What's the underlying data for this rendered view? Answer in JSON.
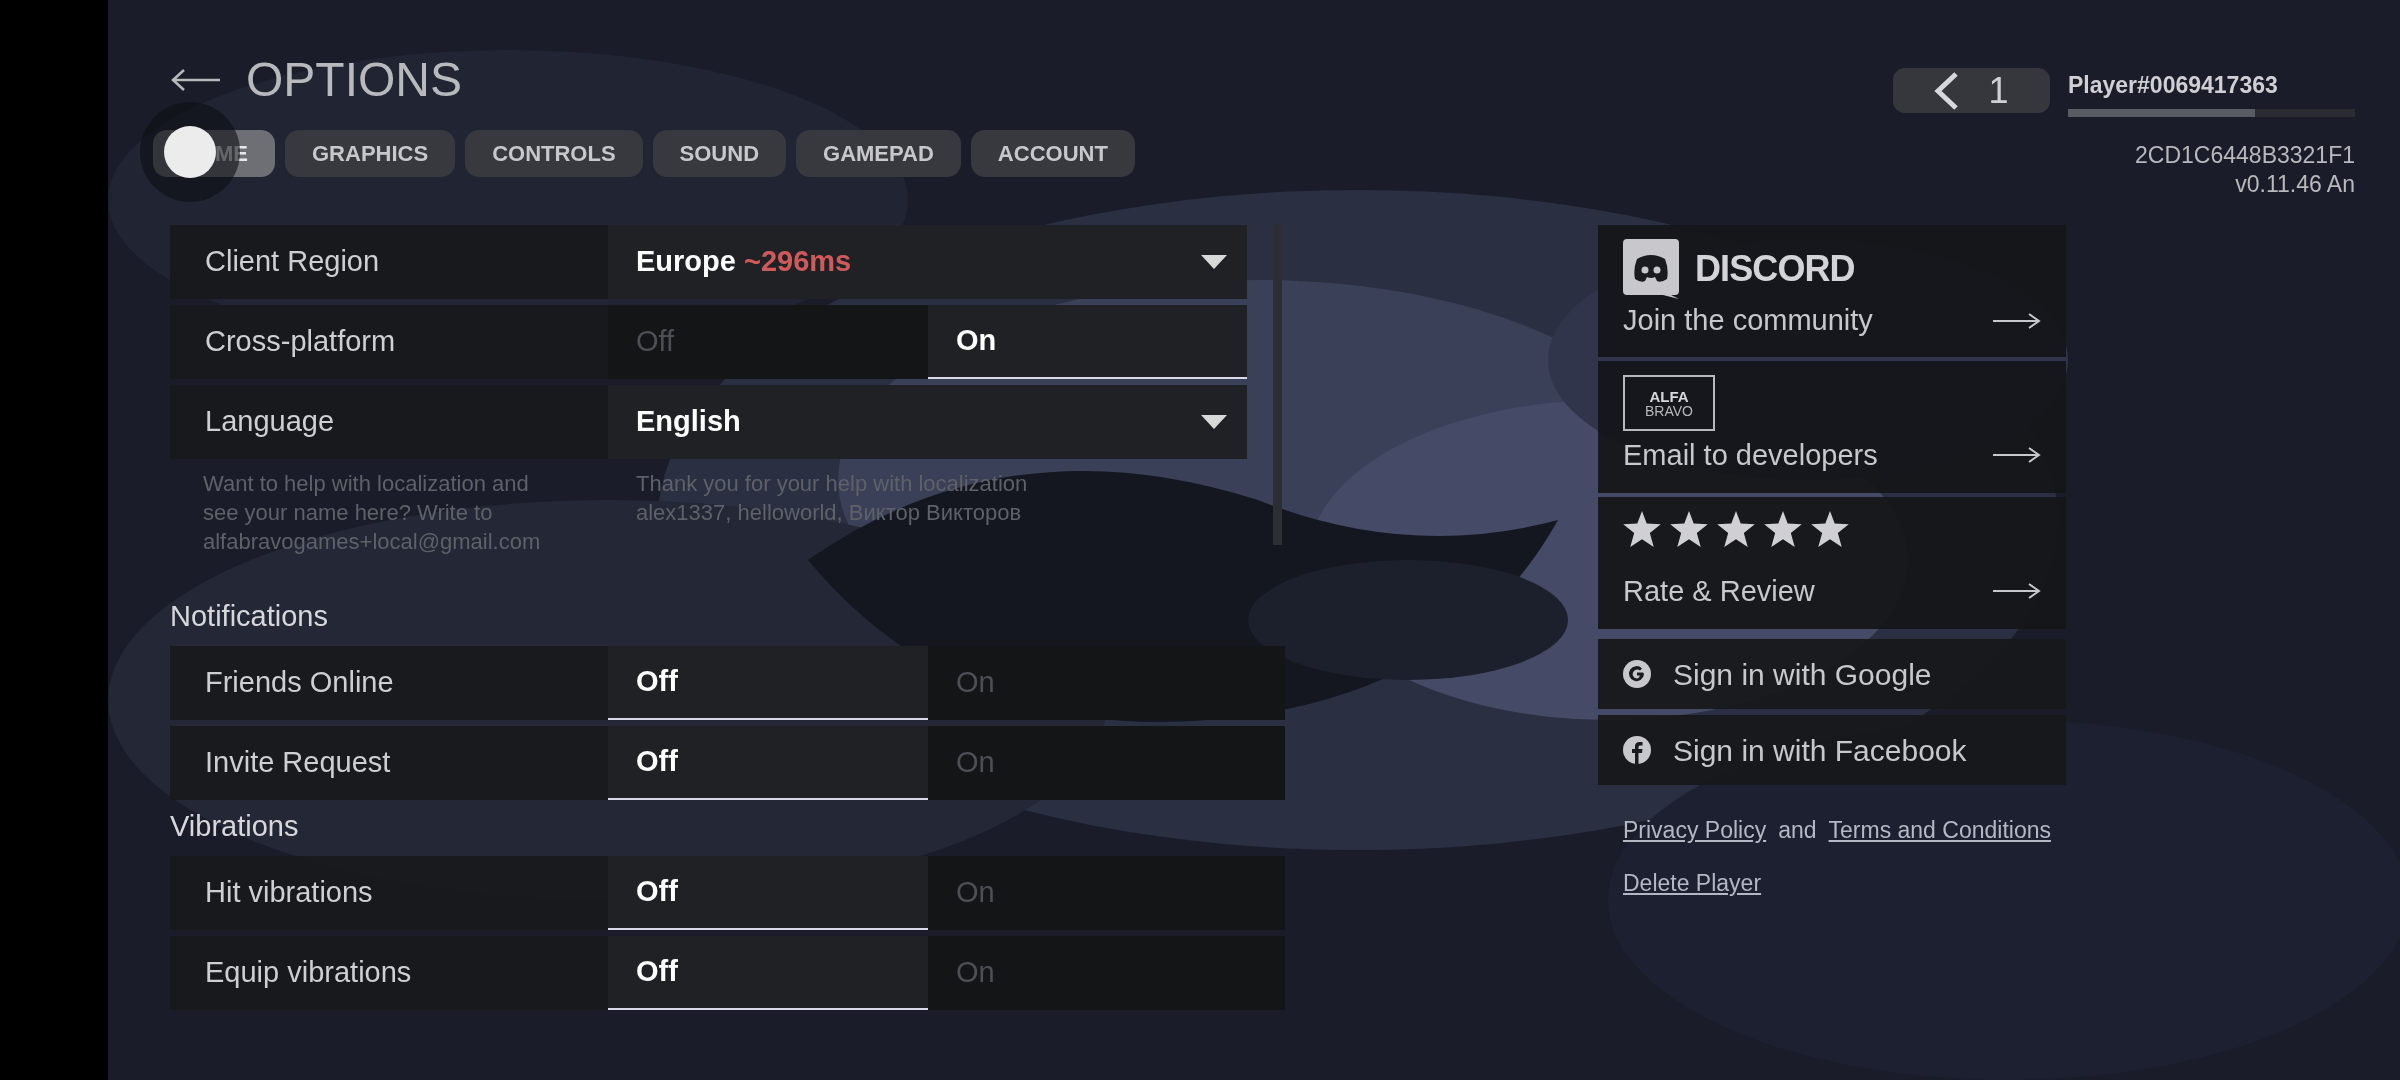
{
  "header": {
    "title": "OPTIONS"
  },
  "tabs": [
    {
      "label": "ME",
      "selected": true
    },
    {
      "label": "GRAPHICS",
      "selected": false
    },
    {
      "label": "CONTROLS",
      "selected": false
    },
    {
      "label": "SOUND",
      "selected": false
    },
    {
      "label": "GAMEPAD",
      "selected": false
    },
    {
      "label": "ACCOUNT",
      "selected": false
    }
  ],
  "general": [
    {
      "kind": "dropdown",
      "label": "Client Region",
      "value": "Europe",
      "ping": "~296ms"
    },
    {
      "kind": "toggle",
      "label": "Cross-platform",
      "off_label": "Off",
      "on_label": "On",
      "on": true
    },
    {
      "kind": "dropdown",
      "label": "Language",
      "value": "English"
    }
  ],
  "localization_note": {
    "request": "Want to help with localization and see your name here? Write to alfabravogames+local@gmail.com",
    "thanks": "Thank you for your help with localization alex1337, helloworld, Виктор Викторов"
  },
  "sections": [
    {
      "title": "Notifications",
      "items": [
        {
          "kind": "toggle",
          "label": "Friends Online",
          "off_label": "Off",
          "on_label": "On",
          "on": false
        },
        {
          "kind": "toggle",
          "label": "Invite Request",
          "off_label": "Off",
          "on_label": "On",
          "on": false
        }
      ]
    },
    {
      "title": "Vibrations",
      "items": [
        {
          "kind": "toggle",
          "label": "Hit vibrations",
          "off_label": "Off",
          "on_label": "On",
          "on": false
        },
        {
          "kind": "toggle",
          "label": "Equip vibrations",
          "off_label": "Off",
          "on_label": "On",
          "on": false
        }
      ]
    }
  ],
  "player": {
    "rank": "1",
    "name": "Player#0069417363",
    "progress": {
      "level": 0.65
    },
    "id": "2CD1C6448B3321F1",
    "version": "v0.11.46 An"
  },
  "links": [
    {
      "kind": "discord",
      "logo_text": "DISCORD",
      "label": "Join the community"
    },
    {
      "kind": "alfabravo",
      "logo_top": "ALFA",
      "logo_bottom": "BRAVO",
      "label": "Email to developers"
    },
    {
      "kind": "rating",
      "stars": 5,
      "label": "Rate & Review"
    }
  ],
  "sign_in": [
    {
      "kind": "google",
      "label": "Sign in with Google"
    },
    {
      "kind": "facebook",
      "label": "Sign in with Facebook"
    }
  ],
  "legal": {
    "privacy": "Privacy Policy",
    "and": "and",
    "terms": "Terms and Conditions",
    "delete": "Delete Player"
  }
}
